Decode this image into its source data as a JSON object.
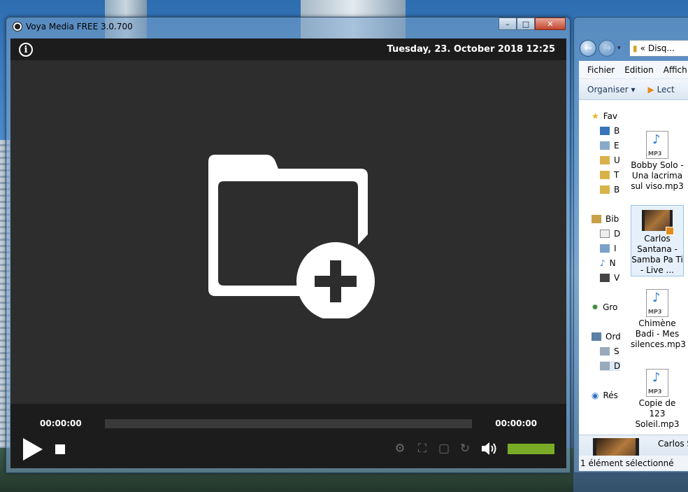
{
  "voya": {
    "title": "Voya Media FREE 3.0.700",
    "datetime": "Tuesday, 23. October 2018 12:25",
    "time_elapsed": "00:00:00",
    "time_total": "00:00:00",
    "volume_level": 1.0,
    "volume_color": "#7aab26",
    "icons": [
      "info-icon",
      "add-folder-icon",
      "play-icon",
      "stop-icon",
      "settings-icon",
      "fullscreen-icon",
      "resize-icon",
      "repeat-icon",
      "volume-icon"
    ]
  },
  "explorer": {
    "address": "Disq...",
    "address_prefix": "«",
    "menu": [
      "Fichier",
      "Edition",
      "Affich"
    ],
    "toolbar": {
      "organize": "Organiser",
      "play": "Lect"
    },
    "tree": {
      "favorites": "Fav",
      "fav_items": [
        "B",
        "E",
        "U",
        "T",
        "B"
      ],
      "libraries": "Bib",
      "lib_items": [
        "D",
        "I",
        "N",
        "V"
      ],
      "group": "Gro",
      "computer": "Ord",
      "comp_items": [
        "S",
        "D"
      ],
      "network": "Rés"
    },
    "files": [
      {
        "name": "Bobby Solo - Una lacrima sul viso.mp3",
        "type": "mp3",
        "selected": false
      },
      {
        "name": "Carlos Santana - Samba Pa Ti  - Live ...",
        "type": "video",
        "selected": true
      },
      {
        "name": "Chimène Badi - Mes silences.mp3",
        "type": "mp3",
        "selected": false
      },
      {
        "name": "Copie de 123 Soleil.mp3",
        "type": "mp3",
        "selected": false
      }
    ],
    "details_name": "Carlos S",
    "status": "1 élément sélectionné"
  }
}
